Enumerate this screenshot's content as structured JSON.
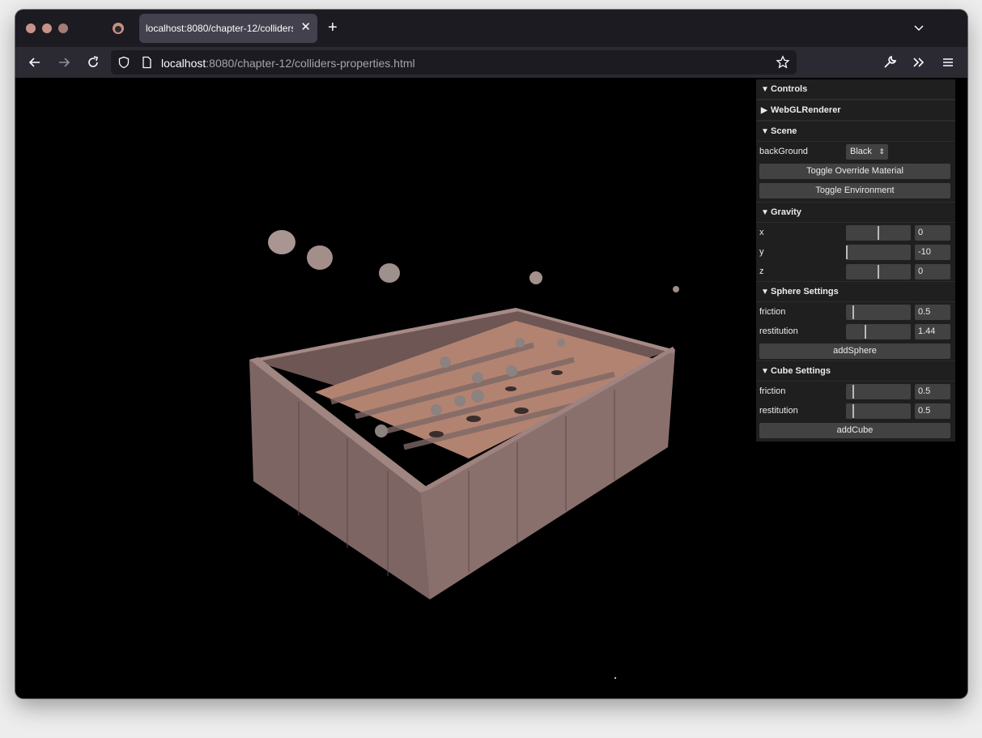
{
  "browser": {
    "tab_title": "localhost:8080/chapter-12/colliders",
    "tab_close": "✕",
    "new_tab": "+",
    "url_host": "localhost",
    "url_rest": ":8080/chapter-12/colliders-properties.html"
  },
  "gui": {
    "title": "Controls",
    "folders": {
      "renderer": "WebGLRenderer",
      "scene": "Scene",
      "gravity": "Gravity",
      "sphere": "Sphere Settings",
      "cube": "Cube Settings"
    },
    "scene": {
      "background_label": "backGround",
      "background_value": "Black",
      "toggle_override": "Toggle Override Material",
      "toggle_environment": "Toggle Environment"
    },
    "gravity": {
      "x_label": "x",
      "x_value": "0",
      "x_fraction": 0.5,
      "y_label": "y",
      "y_value": "-10",
      "y_fraction": 0.0,
      "z_label": "z",
      "z_value": "0",
      "z_fraction": 0.5
    },
    "sphere": {
      "friction_label": "friction",
      "friction_value": "0.5",
      "friction_fraction": 0.1,
      "restitution_label": "restitution",
      "restitution_value": "1.44",
      "restitution_fraction": 0.29,
      "add_label": "addSphere"
    },
    "cube": {
      "friction_label": "friction",
      "friction_value": "0.5",
      "friction_fraction": 0.1,
      "restitution_label": "restitution",
      "restitution_value": "0.5",
      "restitution_fraction": 0.1,
      "add_label": "addCube"
    }
  },
  "colors": {
    "wood": "#8c6f6c",
    "floor": "#b07e6e",
    "sphere": "#a99592"
  }
}
